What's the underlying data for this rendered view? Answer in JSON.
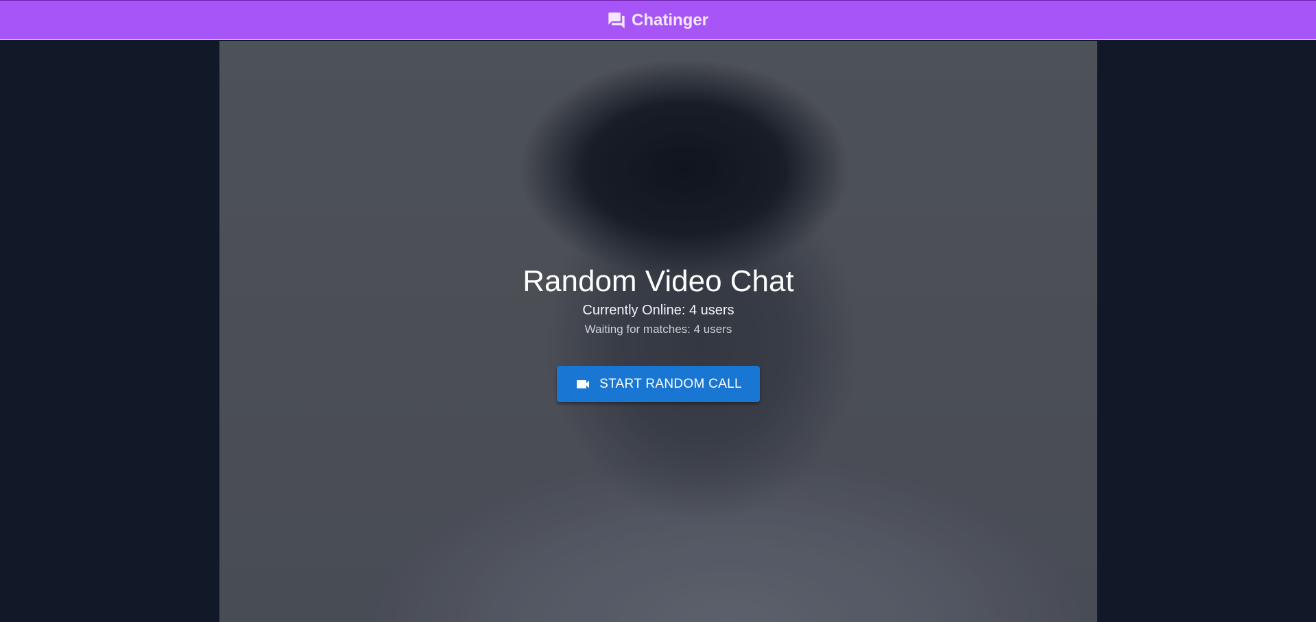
{
  "app": {
    "name": "Chatinger",
    "brand_icon": "chat-bubbles-icon",
    "brand_color": "#a855f7"
  },
  "main": {
    "title": "Random Video Chat",
    "online_text": "Currently Online: 4 users",
    "waiting_text": "Waiting for matches: 4 users",
    "start_button": {
      "label": "START RANDOM CALL",
      "icon": "video-camera-icon",
      "color": "#1976d2"
    }
  }
}
